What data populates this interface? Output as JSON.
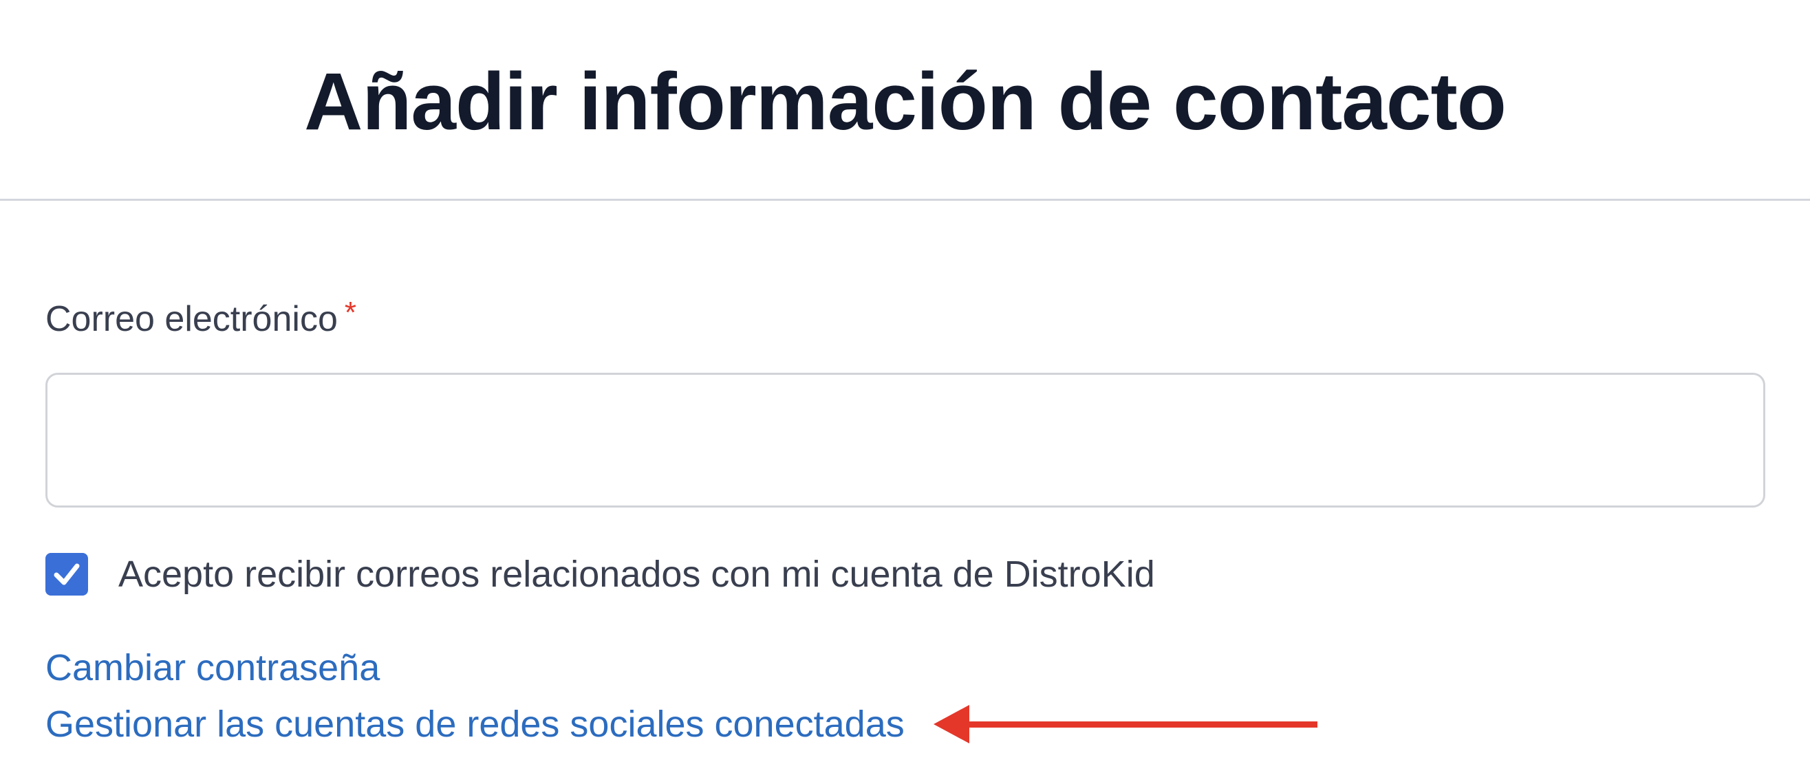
{
  "header": {
    "title": "Añadir información de contacto"
  },
  "form": {
    "email_label": "Correo electrónico",
    "required_mark": "*",
    "email_value": "",
    "email_placeholder": "",
    "consent_label": "Acepto recibir correos relacionados con mi cuenta de DistroKid",
    "consent_checked": true
  },
  "links": {
    "change_password": "Cambiar contraseña",
    "manage_social": "Gestionar las cuentas de redes sociales conectadas"
  },
  "annotation": {
    "arrow_icon": "left-arrow-icon",
    "arrow_color": "#e4372a"
  },
  "colors": {
    "title": "#131a2b",
    "text": "#393f4f",
    "link": "#2c6cbf",
    "checkbox": "#3a6fd8",
    "required": "#e4372a",
    "divider": "#d4d6de"
  }
}
